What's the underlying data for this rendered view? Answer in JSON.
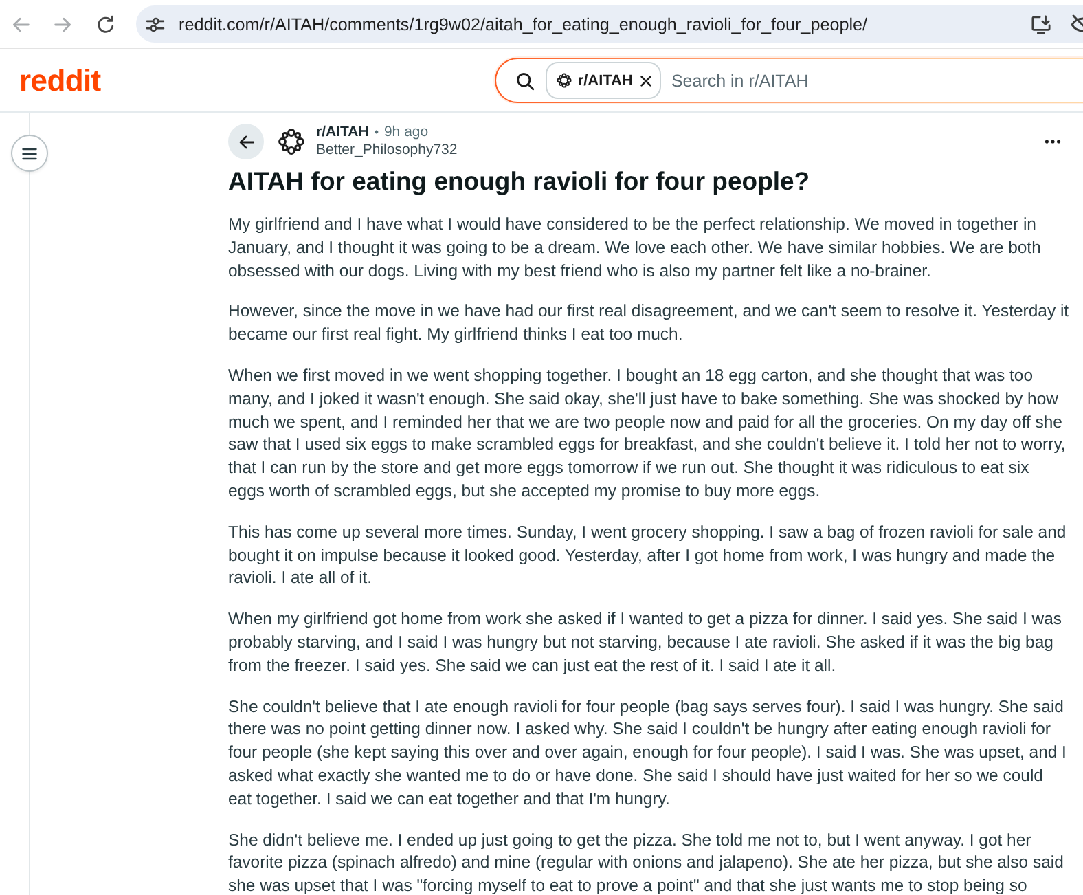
{
  "browser": {
    "nav_buttons": [
      {
        "kind": "back",
        "disabled": true
      },
      {
        "kind": "forward",
        "disabled": true
      },
      {
        "kind": "reload",
        "disabled": false
      }
    ],
    "url": "reddit.com/r/AITAH/comments/1rg9w02/aitah_for_eating_enough_ravioli_for_four_people/"
  },
  "header": {
    "logo": "reddit",
    "search": {
      "chip": "r/AITAH",
      "placeholder": "Search in r/AITAH"
    }
  },
  "post": {
    "subreddit": "r/AITAH",
    "separator": "•",
    "age": "9h ago",
    "author": "Better_Philosophy732",
    "title": "AITAH for eating enough ravioli for four people?",
    "paragraphs": [
      "My girlfriend and I have what I would have considered to be the perfect relationship. We moved in together in January, and I thought it was going to be a dream. We love each other. We have similar hobbies. We are both obsessed with our dogs. Living with my best friend who is also my partner felt like a no-brainer.",
      "However, since the move in we have had our first real disagreement, and we can't seem to resolve it. Yesterday it became our first real fight. My girlfriend thinks I eat too much.",
      "When we first moved in we went shopping together. I bought an 18 egg carton, and she thought that was too many, and I joked it wasn't enough. She said okay, she'll just have to bake something. She was shocked by how much we spent, and I reminded her that we are two people now and paid for all the groceries. On my day off she saw that I used six eggs to make scrambled eggs for breakfast, and she couldn't believe it. I told her not to worry, that I can run by the store and get more eggs tomorrow if we run out. She thought it was ridiculous to eat six eggs worth of scrambled eggs, but she accepted my promise to buy more eggs.",
      "This has come up several more times. Sunday, I went grocery shopping. I saw a bag of frozen ravioli for sale and bought it on impulse because it looked good. Yesterday, after I got home from work, I was hungry and made the ravioli. I ate all of it.",
      "When my girlfriend got home from work she asked if I wanted to get a pizza for dinner. I said yes. She said I was probably starving, and I said I was hungry but not starving, because I ate ravioli. She asked if it was the big bag from the freezer. I said yes. She said we can just eat the rest of it. I said I ate it all.",
      "She couldn't believe that I ate enough ravioli for four people (bag says serves four). I said I was hungry. She said there was no point getting dinner now. I asked why. She said I couldn't be hungry after eating enough ravioli for four people (she kept saying this over and over again, enough for four people). I said I was. She was upset, and I asked what exactly she wanted me to do or have done. She said I should have just waited for her so we could eat together. I said we can eat together and that I'm hungry.",
      "She didn't believe me. I ended up just going to get the pizza. She told me not to, but I went anyway. I got her favorite pizza (spinach alfredo) and mine (regular with onions and jalapeno). She ate her pizza, but she also said she was upset that I was \"forcing myself to eat to prove a point\" and that she just wants me to stop being so"
    ]
  }
}
